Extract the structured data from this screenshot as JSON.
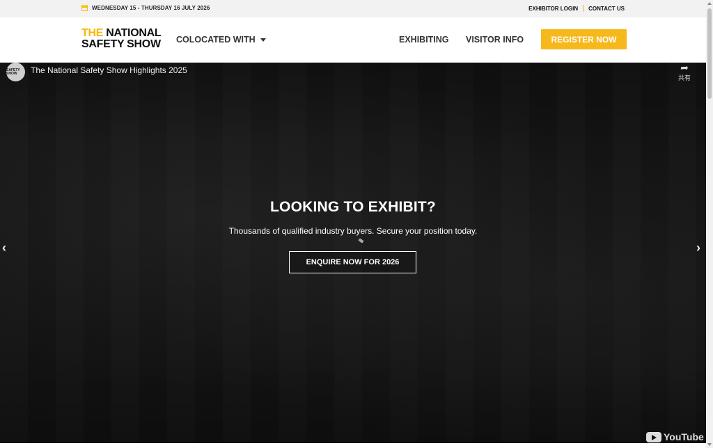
{
  "topbar": {
    "date_text": "WEDNESDAY 15 - THURSDAY 16 JULY 2026",
    "exhibitor_login": "EXHIBITOR LOGIN",
    "contact_us": "CONTACT US"
  },
  "header": {
    "logo": {
      "line1_highlight": "THE",
      "line1_rest": " NATIONAL",
      "line2": "SAFETY SHOW"
    },
    "nav": {
      "colocated": "COLOCATED WITH",
      "exhibiting": "EXHIBITING",
      "visitor_info": "VISITOR INFO"
    },
    "register_label": "REGISTER NOW"
  },
  "video": {
    "channel_avatar_text": "SAFETY SHOW",
    "title": "The National Safety Show Highlights 2025",
    "share_label": "共有",
    "youtube_label": "YouTube"
  },
  "hero": {
    "title": "LOOKING TO EXHIBIT?",
    "subtitle": "Thousands of qualified industry buyers. Secure your position today.",
    "cta_label": "ENQUIRE NOW FOR 2026"
  },
  "colors": {
    "accent": "#f7b81c",
    "hero_bg": "#141414",
    "text_dark": "#333333"
  },
  "icons": {
    "date": "calendar-icon",
    "share": "share-icon",
    "prev": "chevron-left-icon",
    "next": "chevron-right-icon",
    "dropdown": "caret-down-icon"
  }
}
